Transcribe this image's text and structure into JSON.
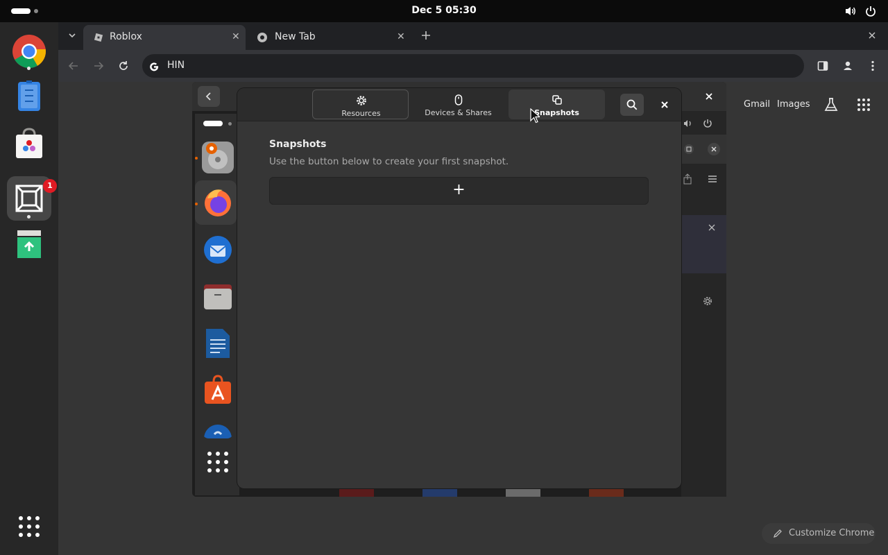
{
  "topbar": {
    "clock": "Dec 5  05:30"
  },
  "chrome": {
    "tabs": [
      {
        "title": "Roblox"
      },
      {
        "title": "New Tab"
      }
    ],
    "omnibox_value": "HIN",
    "links": {
      "gmail": "Gmail",
      "images": "Images"
    },
    "customize_label": "Customize Chrome"
  },
  "dock": {
    "items": [
      "chrome-app",
      "text-editor-app",
      "software-store-app",
      "vm-manager-app",
      "recycle-bin-app"
    ],
    "vm_badge": "1"
  },
  "dialog": {
    "tabs": [
      {
        "label": "Resources",
        "icon": "gear-icon"
      },
      {
        "label": "Devices & Shares",
        "icon": "mouse-icon"
      },
      {
        "label": "Snapshots",
        "icon": "copy-icon"
      }
    ],
    "heading": "Snapshots",
    "subtext": "Use the button below to create your first snapshot.",
    "add_label": "+"
  },
  "colors": {
    "accent": "#e01b24",
    "chrome_bg": "#35363a",
    "dialog_bg": "#363636"
  }
}
